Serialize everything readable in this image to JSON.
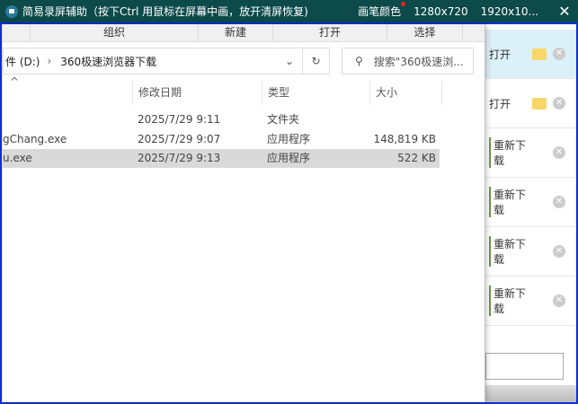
{
  "titlebar": {
    "title": "简易录屏辅助（按下Ctrl 用鼠标在屏幕中画，放开清屏恢复)",
    "pen_color": "画笔颜色",
    "res1": "1280x720",
    "res2": "1920x10...",
    "close": "✕"
  },
  "toolbar": {
    "organize": "组织",
    "new": "新建",
    "open": "打开",
    "select": "选择"
  },
  "address": {
    "drive": "件 (D:)",
    "folder": "360极速浏览器下载",
    "search_placeholder": "搜索\"360极速浏..."
  },
  "columns": {
    "date": "修改日期",
    "type": "类型",
    "size": "大小"
  },
  "files": [
    {
      "name": "",
      "date": "2025/7/29 9:11",
      "type": "文件夹",
      "size": ""
    },
    {
      "name": "gChang.exe",
      "date": "2025/7/29 9:07",
      "type": "应用程序",
      "size": "148,819 KB"
    },
    {
      "name": "u.exe",
      "date": "2025/7/29 9:13",
      "type": "应用程序",
      "size": "522 KB"
    }
  ],
  "downloads": [
    {
      "action": "打开"
    },
    {
      "action": "打开"
    },
    {
      "action": "重新下载"
    },
    {
      "action": "重新下载"
    },
    {
      "action": "重新下载"
    },
    {
      "action": "重新下载"
    }
  ]
}
